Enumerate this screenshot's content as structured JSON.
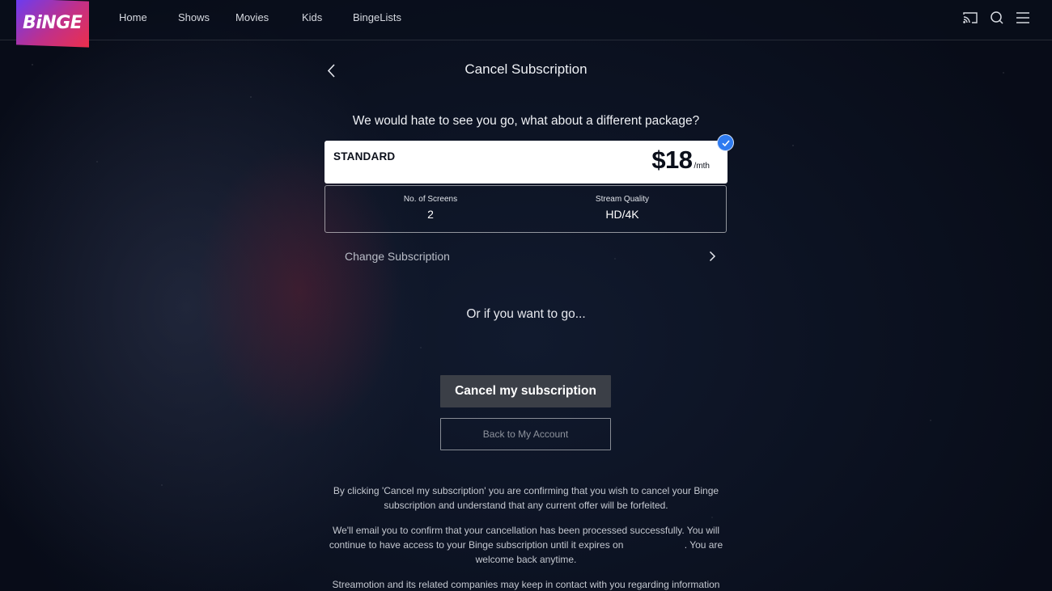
{
  "header": {
    "logo_text": "BiNGE",
    "nav": [
      "Home",
      "Shows",
      "Movies",
      "Kids",
      "BingeLists"
    ]
  },
  "page": {
    "title": "Cancel Subscription",
    "prompt": "We would hate to see you go, what about a different package?"
  },
  "plan": {
    "name": "STANDARD",
    "price": "$18",
    "price_unit": "/mth",
    "selected": true,
    "screens_label": "No. of Screens",
    "screens_value": "2",
    "quality_label": "Stream Quality",
    "quality_value": "HD/4K"
  },
  "change_subscription_label": "Change Subscription",
  "or_text": "Or if you want to go...",
  "buttons": {
    "cancel_label": "Cancel my subscription",
    "back_label": "Back to My Account"
  },
  "legal": {
    "p1": "By clicking 'Cancel my subscription' you are confirming that you wish to cancel your Binge subscription and understand that any current offer will be forfeited.",
    "p2_before": "We'll email you to confirm that your cancellation has been processed successfully. You will continue to have access to your Binge subscription until it expires on",
    "p2_after": ". You are welcome back anytime.",
    "p3": "Streamotion and its related companies may keep in contact with you regarding information"
  },
  "colors": {
    "accent_blue": "#2f7bf0",
    "logo_gradient_start": "#6a3cf2",
    "logo_gradient_end": "#ec2f4b",
    "background": "#0c1222"
  },
  "icons": {
    "cast": "cast-icon",
    "search": "search-icon",
    "menu": "menu-icon",
    "back": "chevron-left-icon",
    "check": "check-icon",
    "forward": "chevron-right-icon"
  }
}
